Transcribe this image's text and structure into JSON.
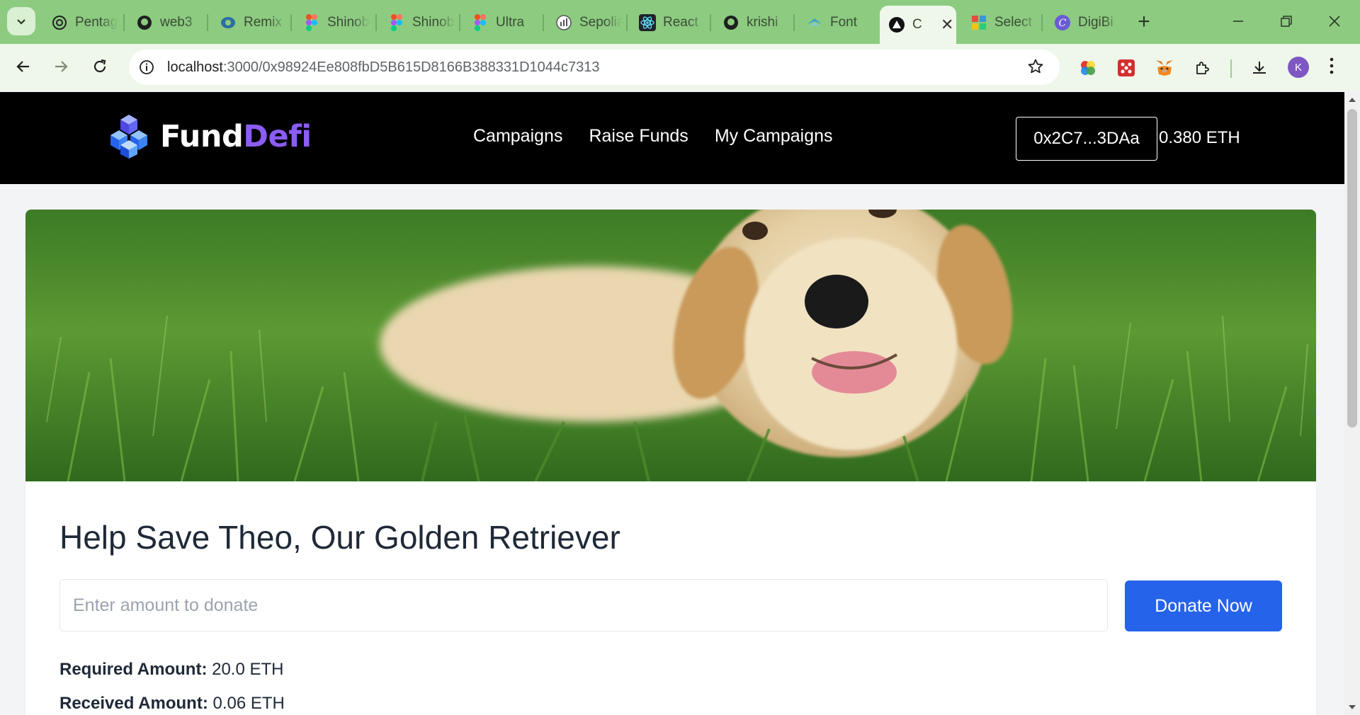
{
  "browser": {
    "tabs": [
      {
        "label": "Pentagram",
        "icon": "openai-icon"
      },
      {
        "label": "web3",
        "icon": "github-icon"
      },
      {
        "label": "Remix",
        "icon": "remix-icon"
      },
      {
        "label": "Shinobi",
        "icon": "figma-icon"
      },
      {
        "label": "Shinobi",
        "icon": "figma-icon"
      },
      {
        "label": "Ultra",
        "icon": "figma-icon"
      },
      {
        "label": "Sepolia",
        "icon": "etherscan-icon"
      },
      {
        "label": "React",
        "icon": "react-icon"
      },
      {
        "label": "krishi",
        "icon": "github-icon"
      },
      {
        "label": "Font",
        "icon": "fontshare-icon"
      },
      {
        "label": "C",
        "icon": "app-icon",
        "active": true
      },
      {
        "label": "Select",
        "icon": "color-icon"
      },
      {
        "label": "DigiBi",
        "icon": "canva-icon"
      }
    ],
    "new_tab_label": "+",
    "url_host": "localhost",
    "url_path": ":3000/0x98924Ee808fbD5B615D8166B388331D1044c7313",
    "profile_initial": "K"
  },
  "site": {
    "logo_main": "Fund",
    "logo_accent": "Defi",
    "nav": [
      "Campaigns",
      "Raise Funds",
      "My Campaigns"
    ],
    "wallet_address": "0x2C7...3DAa",
    "balance": "0.380 ETH"
  },
  "campaign": {
    "title": "Help Save Theo, Our Golden Retriever",
    "donate_placeholder": "Enter amount to donate",
    "donate_button": "Donate Now",
    "required_label": "Required Amount:",
    "required_value": " 20.0 ETH",
    "received_label": "Received Amount:",
    "received_value": " 0.06 ETH"
  },
  "colors": {
    "tab_strip": "#8ccb80",
    "header_bg": "#000000",
    "logo_accent": "#8b5cf6",
    "button": "#2563eb"
  }
}
